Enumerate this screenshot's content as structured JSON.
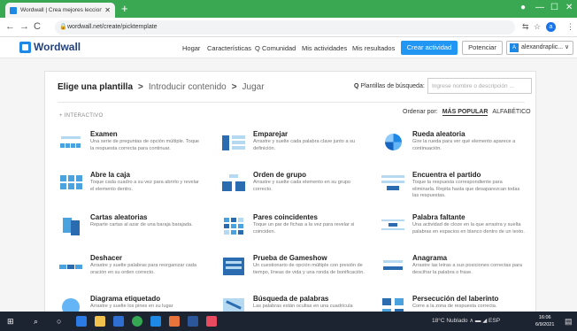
{
  "browser": {
    "tab_title": "Wordwall | Crea mejores leccion",
    "tab_close": "✕",
    "new_tab": "+",
    "back": "←",
    "forward": "→",
    "reload": "C",
    "url": "wordwall.net/create/picktemplate",
    "lock": "🔒",
    "translate_icon": "⇆",
    "star_icon": "☆",
    "profile_initial": "a",
    "menu_icon": "⋮",
    "window_minimize": "—",
    "window_maximize": "☐",
    "window_close": "✕",
    "record_icon": "●"
  },
  "header": {
    "logo_text": "Wordwall",
    "nav": [
      "Hogar",
      "Características",
      "Comunidad",
      "Mis actividades",
      "Mis resultados"
    ],
    "community_icon": "Q",
    "create_button": "Crear actividad",
    "upgrade_button": "Potenciar",
    "user_name": "alexandraplic... ∨",
    "user_initial": "A"
  },
  "page": {
    "breadcrumb_active": "Elige una plantilla",
    "breadcrumb_2": "Introducir contenido",
    "breadcrumb_3": "Jugar",
    "chevron": ">",
    "search_label": "Plantillas de búsqueda:",
    "search_icon": "Q",
    "search_placeholder": "Ingrese nombre o descripción ...",
    "sort_label": "Ordenar por:",
    "sort_popular": "MÁS POPULAR",
    "sort_alpha": "ALFABÉTICO",
    "section_label": "+ INTERACTIVO"
  },
  "templates": [
    {
      "name": "Examen",
      "desc": "Una serie de preguntas de opción múltiple. Toque la respuesta correcta para continuar."
    },
    {
      "name": "Emparejar",
      "desc": "Arrastre y suelte cada palabra clave junto a su definición."
    },
    {
      "name": "Rueda aleatoria",
      "desc": "Gire la rueda para ver qué elemento aparece a continuación."
    },
    {
      "name": "Abre la caja",
      "desc": "Toque cada cuadro a su vez para abrirlo y revelar el elemento dentro."
    },
    {
      "name": "Orden de grupo",
      "desc": "Arrastre y suelte cada elemento en su grupo correcto."
    },
    {
      "name": "Encuentra el partido",
      "desc": "Toque la respuesta correspondiente para eliminarla. Repita hasta que desaparezcan todas las respuestas."
    },
    {
      "name": "Cartas aleatorias",
      "desc": "Reparte cartas al azar de una baraja barajada."
    },
    {
      "name": "Pares coincidentes",
      "desc": "Toque un par de fichas a la vez para revelar si coinciden."
    },
    {
      "name": "Palabra faltante",
      "desc": "Una actividad de cloze en la que arrastra y suelta palabras en espacios en blanco dentro de un texto."
    },
    {
      "name": "Deshacer",
      "desc": "Arrastre y suelte palabras para reorganizar cada oración en su orden correcto."
    },
    {
      "name": "Prueba de Gameshow",
      "desc": "Un cuestionario de opción múltiple con presión de tiempo, líneas de vida y una ronda de bonificación."
    },
    {
      "name": "Anagrama",
      "desc": "Arrastre las letras a sus posiciones correctas para descifrar la palabra o frase."
    },
    {
      "name": "Diagrama etiquetado",
      "desc": "Arrastre y suelte los pines en su lugar"
    },
    {
      "name": "Búsqueda de palabras",
      "desc": "Las palabras están ocultas en una cuadrícula"
    },
    {
      "name": "Persecución del laberinto",
      "desc": "Corre a la zona de respuesta correcta."
    }
  ],
  "taskbar": {
    "start_icon": "⊞",
    "search_icon": "⌕",
    "cortana_icon": "○",
    "tray_text": "18°C Nublado  ∧  ▬  ◢  ESP",
    "time": "16:06",
    "date": "6/9/2021",
    "notify_icon": "▤"
  }
}
